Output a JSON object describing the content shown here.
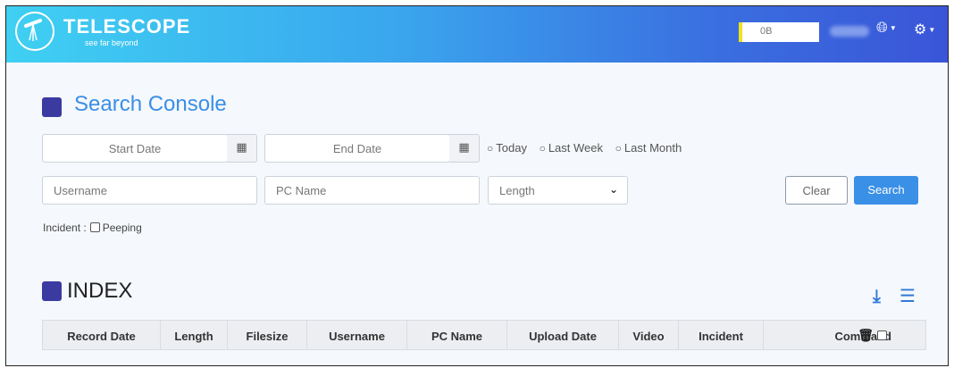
{
  "header": {
    "brand_title": "TELESCOPE",
    "brand_subtitle": "see far beyond",
    "quota_value": "0B",
    "accent_color": "#3a8fe6",
    "brand_square_color": "#3b3aa0"
  },
  "search_console": {
    "title": "Search Console",
    "start_date_placeholder": "Start Date",
    "end_date_placeholder": "End Date",
    "calendar_icon": "calendar-icon",
    "radios": [
      "Today",
      "Last Week",
      "Last Month"
    ],
    "username_placeholder": "Username",
    "pcname_placeholder": "PC Name",
    "length_selected": "Length",
    "clear_label": "Clear",
    "search_label": "Search",
    "incident_label": "Incident :",
    "incident_option": "Peeping"
  },
  "index": {
    "title": "INDEX",
    "columns": [
      "Record Date",
      "Length",
      "Filesize",
      "Username",
      "PC Name",
      "Upload Date",
      "Video",
      "Incident",
      "Command"
    ]
  }
}
